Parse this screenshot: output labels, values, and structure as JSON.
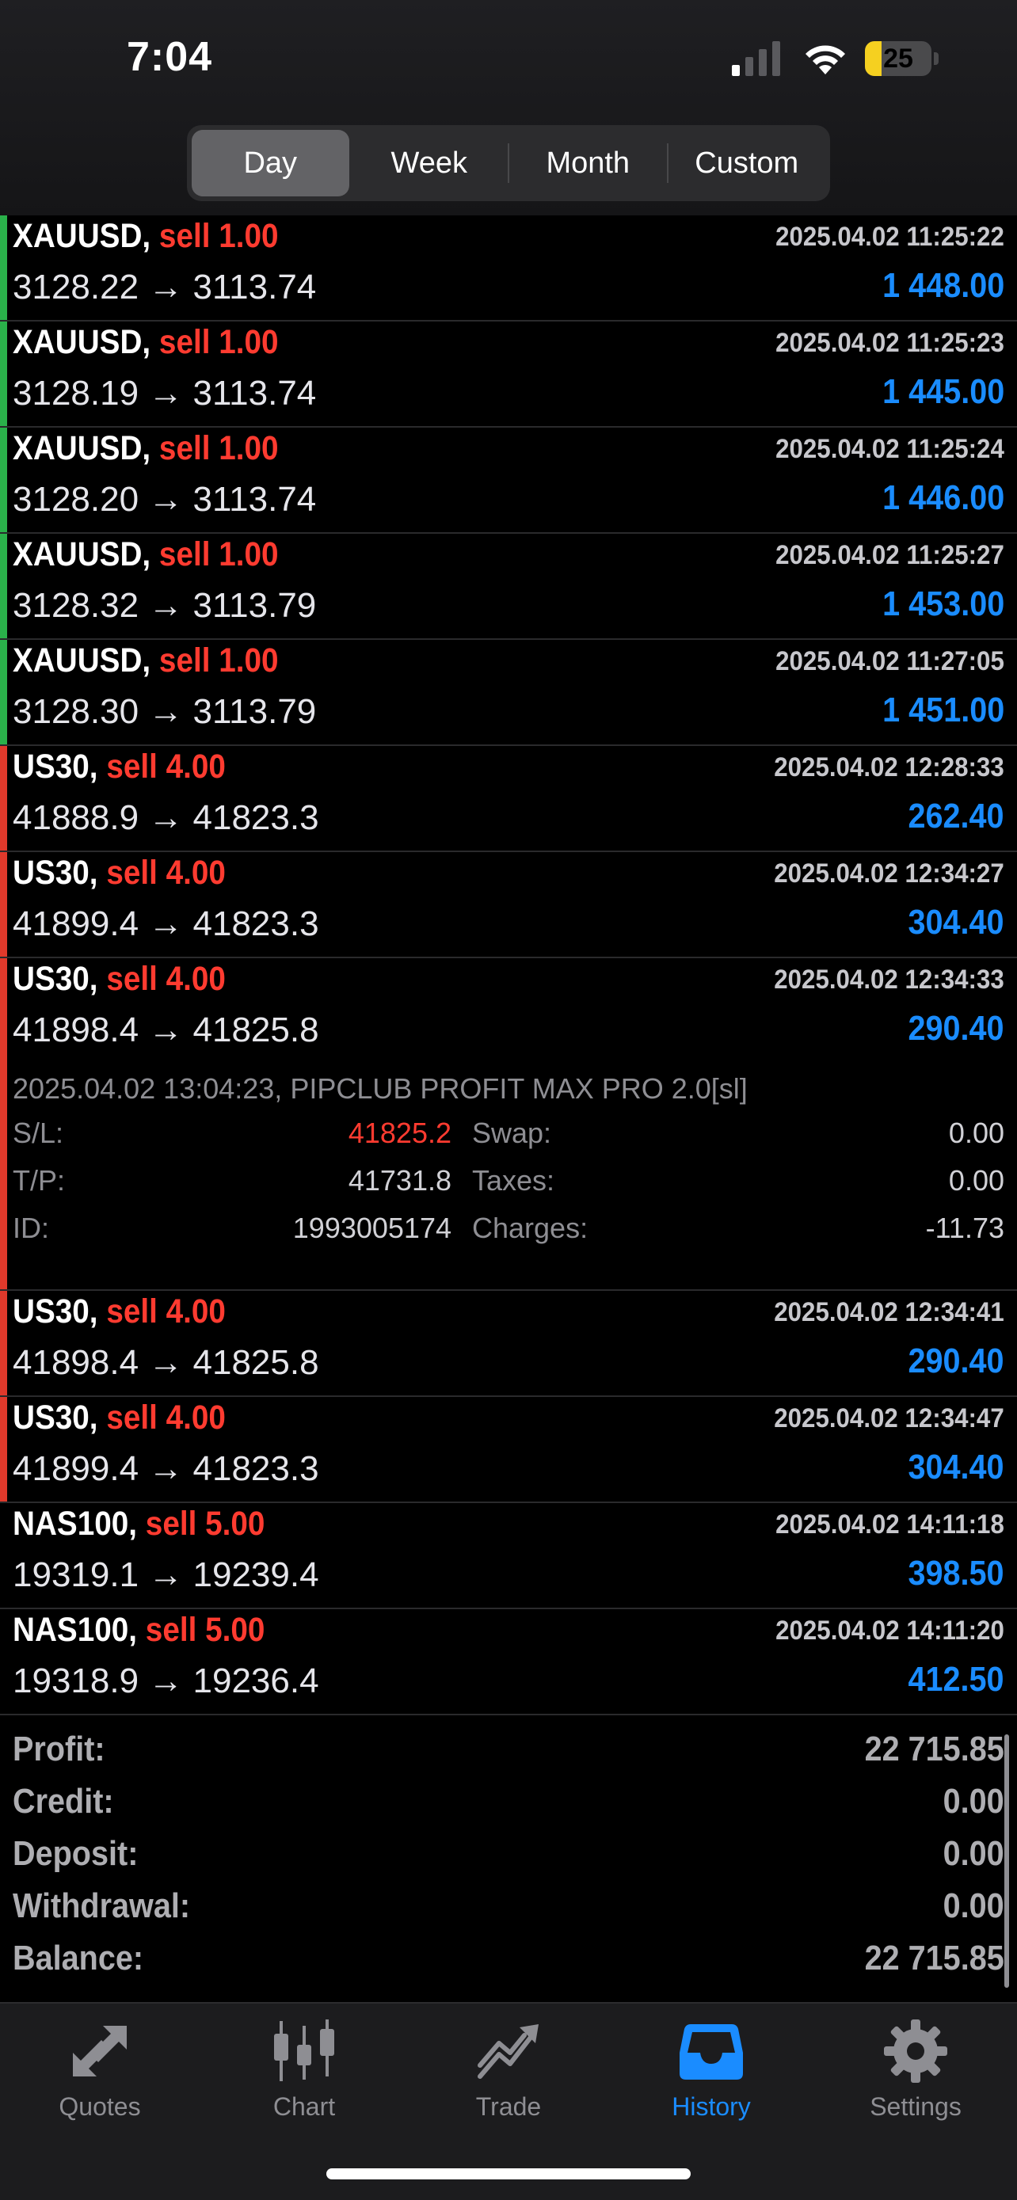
{
  "status_bar": {
    "time": "7:04",
    "battery_percent": "25",
    "battery_level": 0.25,
    "battery_color": "#f5d020"
  },
  "periods": {
    "options": [
      "Day",
      "Week",
      "Month",
      "Custom"
    ],
    "selected": "Day"
  },
  "colors": {
    "profit": "#1a8cff",
    "sell": "#ff3b30",
    "indicator_gold": "#2ab14a",
    "indicator_index": "#e0392b",
    "accent": "#1a8cff"
  },
  "deals": [
    {
      "symbol": "XAUUSD,",
      "side": "sell 1.00",
      "time": "2025.04.02 11:25:22",
      "prices": "3128.22 → 3113.74",
      "profit": "1 448.00"
    },
    {
      "symbol": "XAUUSD,",
      "side": "sell 1.00",
      "time": "2025.04.02 11:25:23",
      "prices": "3128.19 → 3113.74",
      "profit": "1 445.00"
    },
    {
      "symbol": "XAUUSD,",
      "side": "sell 1.00",
      "time": "2025.04.02 11:25:24",
      "prices": "3128.20 → 3113.74",
      "profit": "1 446.00"
    },
    {
      "symbol": "XAUUSD,",
      "side": "sell 1.00",
      "time": "2025.04.02 11:25:27",
      "prices": "3128.32 → 3113.79",
      "profit": "1 453.00"
    },
    {
      "symbol": "XAUUSD,",
      "side": "sell 1.00",
      "time": "2025.04.02 11:27:05",
      "prices": "3128.30 → 3113.79",
      "profit": "1 451.00"
    },
    {
      "symbol": "US30,",
      "side": "sell 4.00",
      "time": "2025.04.02 12:28:33",
      "prices": "41888.9 → 41823.3",
      "profit": "262.40"
    },
    {
      "symbol": "US30,",
      "side": "sell 4.00",
      "time": "2025.04.02 12:34:27",
      "prices": "41899.4 → 41823.3",
      "profit": "304.40"
    },
    {
      "symbol": "US30,",
      "side": "sell 4.00",
      "time": "2025.04.02 12:34:33",
      "prices": "41898.4 → 41825.8",
      "profit": "290.40",
      "details": {
        "comment": "2025.04.02 13:04:23, PIPCLUB PROFIT MAX PRO 2.0[sl]",
        "sl_label": "S/L:",
        "sl_value": "41825.2",
        "tp_label": "T/P:",
        "tp_value": "41731.8",
        "id_label": "ID:",
        "id_value": "1993005174",
        "swap_label": "Swap:",
        "swap_value": "0.00",
        "taxes_label": "Taxes:",
        "taxes_value": "0.00",
        "charges_label": "Charges:",
        "charges_value": "-11.73"
      }
    },
    {
      "symbol": "US30,",
      "side": "sell 4.00",
      "time": "2025.04.02 12:34:41",
      "prices": "41898.4 → 41825.8",
      "profit": "290.40"
    },
    {
      "symbol": "US30,",
      "side": "sell 4.00",
      "time": "2025.04.02 12:34:47",
      "prices": "41899.4 → 41823.3",
      "profit": "304.40"
    },
    {
      "symbol": "NAS100,",
      "side": "sell 5.00",
      "time": "2025.04.02 14:11:18",
      "prices": "19319.1 → 19239.4",
      "profit": "398.50"
    },
    {
      "symbol": "NAS100,",
      "side": "sell 5.00",
      "time": "2025.04.02 14:11:20",
      "prices": "19318.9 → 19236.4",
      "profit": "412.50"
    }
  ],
  "summary": {
    "profit_label": "Profit:",
    "profit_value": "22 715.85",
    "credit_label": "Credit:",
    "credit_value": "0.00",
    "deposit_label": "Deposit:",
    "deposit_value": "0.00",
    "withdrawal_label": "Withdrawal:",
    "withdrawal_value": "0.00",
    "balance_label": "Balance:",
    "balance_value": "22 715.85"
  },
  "tabs": [
    {
      "label": "Quotes",
      "icon": "quotes-icon"
    },
    {
      "label": "Chart",
      "icon": "candlestick-chart-icon"
    },
    {
      "label": "Trade",
      "icon": "trade-trend-icon"
    },
    {
      "label": "History",
      "icon": "inbox-tray-icon"
    },
    {
      "label": "Settings",
      "icon": "gear-icon"
    }
  ],
  "active_tab": "History"
}
